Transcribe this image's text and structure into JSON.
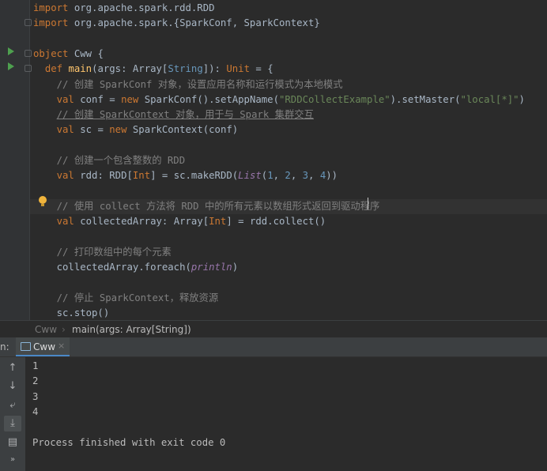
{
  "editor": {
    "lines": [
      {
        "parts": [
          {
            "t": "import",
            "c": "kw"
          },
          {
            "t": " org.apache.spark.rdd.RDD"
          }
        ]
      },
      {
        "parts": [
          {
            "t": "import",
            "c": "kw"
          },
          {
            "t": " org.apache.spark.{SparkConf, SparkContext}"
          }
        ]
      },
      {
        "parts": []
      },
      {
        "parts": [
          {
            "t": "object",
            "c": "kw"
          },
          {
            "t": " Cww {"
          }
        ]
      },
      {
        "parts": [
          {
            "t": "  "
          },
          {
            "t": "def",
            "c": "kw"
          },
          {
            "t": " "
          },
          {
            "t": "main",
            "c": "fn"
          },
          {
            "t": "(args: Array["
          },
          {
            "t": "String",
            "c": "ty"
          },
          {
            "t": "]): "
          },
          {
            "t": "Unit",
            "c": "kw"
          },
          {
            "t": " = {"
          }
        ]
      },
      {
        "parts": [
          {
            "t": "    // 创建 SparkConf 对象，设置应用名称和运行模式为本地模式",
            "c": "cmt"
          }
        ]
      },
      {
        "parts": [
          {
            "t": "    "
          },
          {
            "t": "val",
            "c": "kw"
          },
          {
            "t": " conf = "
          },
          {
            "t": "new",
            "c": "kw"
          },
          {
            "t": " SparkConf().setAppName("
          },
          {
            "t": "\"RDDCollectExample\"",
            "c": "str"
          },
          {
            "t": ").setMaster("
          },
          {
            "t": "\"local[*]\"",
            "c": "str"
          },
          {
            "t": ")"
          }
        ]
      },
      {
        "parts": [
          {
            "t": "    "
          },
          {
            "t": "// 创建 SparkContext 对象，用于与 Spark 集群交互",
            "c": "cmt ulc"
          }
        ]
      },
      {
        "parts": [
          {
            "t": "    "
          },
          {
            "t": "val",
            "c": "kw"
          },
          {
            "t": " sc = "
          },
          {
            "t": "new",
            "c": "kw"
          },
          {
            "t": " SparkContext(conf)"
          }
        ]
      },
      {
        "parts": []
      },
      {
        "parts": [
          {
            "t": "    // 创建一个包含整数的 RDD",
            "c": "cmt"
          }
        ]
      },
      {
        "parts": [
          {
            "t": "    "
          },
          {
            "t": "val",
            "c": "kw"
          },
          {
            "t": " rdd: RDD["
          },
          {
            "t": "Int",
            "c": "kw"
          },
          {
            "t": "] = sc.makeRDD("
          },
          {
            "t": "List",
            "c": "ital"
          },
          {
            "t": "("
          },
          {
            "t": "1",
            "c": "num"
          },
          {
            "t": ", "
          },
          {
            "t": "2",
            "c": "num"
          },
          {
            "t": ", "
          },
          {
            "t": "3",
            "c": "num"
          },
          {
            "t": ", "
          },
          {
            "t": "4",
            "c": "num"
          },
          {
            "t": "))"
          }
        ]
      },
      {
        "parts": []
      },
      {
        "parts": [
          {
            "t": "    // 使用 collect 方法将 RDD 中的所有元素以数组形式返回到驱动程序",
            "c": "cmt"
          }
        ]
      },
      {
        "parts": [
          {
            "t": "    "
          },
          {
            "t": "val",
            "c": "kw"
          },
          {
            "t": " collectedArray: Array["
          },
          {
            "t": "Int",
            "c": "kw"
          },
          {
            "t": "] = rdd.collect()"
          }
        ]
      },
      {
        "parts": []
      },
      {
        "parts": [
          {
            "t": "    // 打印数组中的每个元素",
            "c": "cmt"
          }
        ]
      },
      {
        "parts": [
          {
            "t": "    collectedArray.foreach("
          },
          {
            "t": "println",
            "c": "ital"
          },
          {
            "t": ")"
          }
        ]
      },
      {
        "parts": []
      },
      {
        "parts": [
          {
            "t": "    // 停止 SparkContext，释放资源",
            "c": "cmt"
          }
        ]
      },
      {
        "parts": [
          {
            "t": "    sc.stop()"
          }
        ]
      }
    ]
  },
  "breadcrumb": {
    "root": "Cww",
    "chevron": "›",
    "current": "main(args: Array[String])"
  },
  "run_panel": {
    "label": "n:",
    "tab": {
      "label": "Cww",
      "close": "×"
    },
    "output": [
      "1",
      "2",
      "3",
      "4",
      "",
      "Process finished with exit code 0"
    ]
  },
  "tools": [
    {
      "name": "up-arrow-icon",
      "glyph": "↑"
    },
    {
      "name": "down-arrow-icon",
      "glyph": "↓"
    },
    {
      "name": "soft-wrap-icon",
      "glyph": "⤶"
    },
    {
      "name": "scroll-to-end-icon",
      "glyph": "⤓"
    },
    {
      "name": "print-icon",
      "glyph": "▤"
    },
    {
      "name": "more-icon",
      "glyph": "»"
    }
  ],
  "colors": {
    "run_icon": "#4ea04f",
    "bulb": "#f0b43c",
    "tab_accent": "#4a88c7"
  }
}
